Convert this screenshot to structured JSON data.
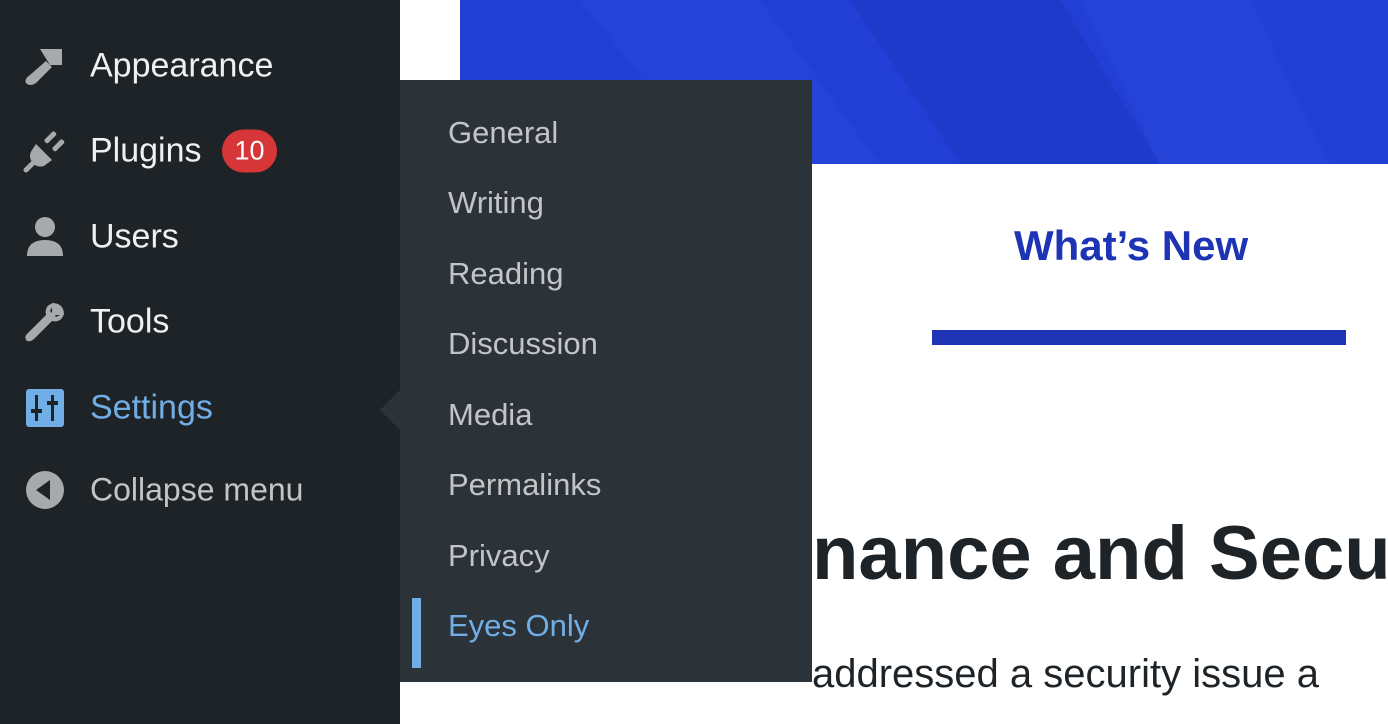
{
  "sidebar": {
    "items": [
      {
        "label": "Appearance",
        "icon": "paintbrush-icon"
      },
      {
        "label": "Plugins",
        "icon": "plug-icon",
        "badge": "10"
      },
      {
        "label": "Users",
        "icon": "user-icon"
      },
      {
        "label": "Tools",
        "icon": "wrench-icon"
      },
      {
        "label": "Settings",
        "icon": "sliders-icon",
        "current": true
      },
      {
        "label": "Collapse menu",
        "icon": "collapse-arrow-icon"
      }
    ]
  },
  "submenu": {
    "items": [
      {
        "label": "General"
      },
      {
        "label": "Writing"
      },
      {
        "label": "Reading"
      },
      {
        "label": "Discussion"
      },
      {
        "label": "Media"
      },
      {
        "label": "Permalinks"
      },
      {
        "label": "Privacy"
      },
      {
        "label": "Eyes Only",
        "current": true
      }
    ]
  },
  "main": {
    "tab_label": "What’s New",
    "headline": "nance and Secu",
    "body_text": "addressed a security issue a"
  },
  "colors": {
    "sidebar_bg": "#1d2327",
    "submenu_bg": "#2c3338",
    "accent_blue": "#72aee6",
    "badge_red": "#d63638",
    "hero_blue": "#213fd4",
    "link_blue": "#1d35b4"
  }
}
